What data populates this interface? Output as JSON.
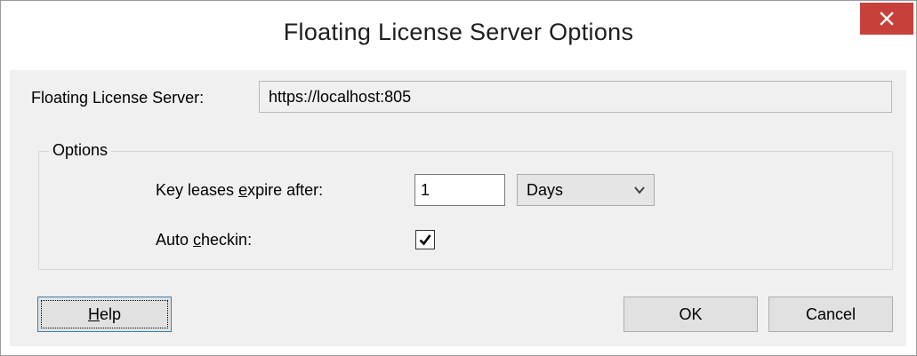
{
  "window": {
    "title": "Floating License Server Options"
  },
  "server": {
    "label": "Floating License Server:",
    "value": "https://localhost:805"
  },
  "options": {
    "legend": "Options",
    "expire_label_pre": "Key leases ",
    "expire_label_mnemonic": "e",
    "expire_label_post": "xpire after:",
    "expire_value": "1",
    "unit_selected": "Days",
    "autocheckin_label_pre": "Auto ",
    "autocheckin_label_mnemonic": "c",
    "autocheckin_label_post": "heckin:",
    "autocheckin_checked": true
  },
  "buttons": {
    "help_mnemonic": "H",
    "help_rest": "elp",
    "ok": "OK",
    "cancel": "Cancel"
  },
  "colors": {
    "close_button": "#c7413a",
    "dialog_background": "#f0f0f0",
    "focus_border": "#3c7fb1"
  },
  "icons": {
    "close": "close-icon",
    "dropdown": "chevron-down-icon",
    "check": "checkmark-icon"
  }
}
